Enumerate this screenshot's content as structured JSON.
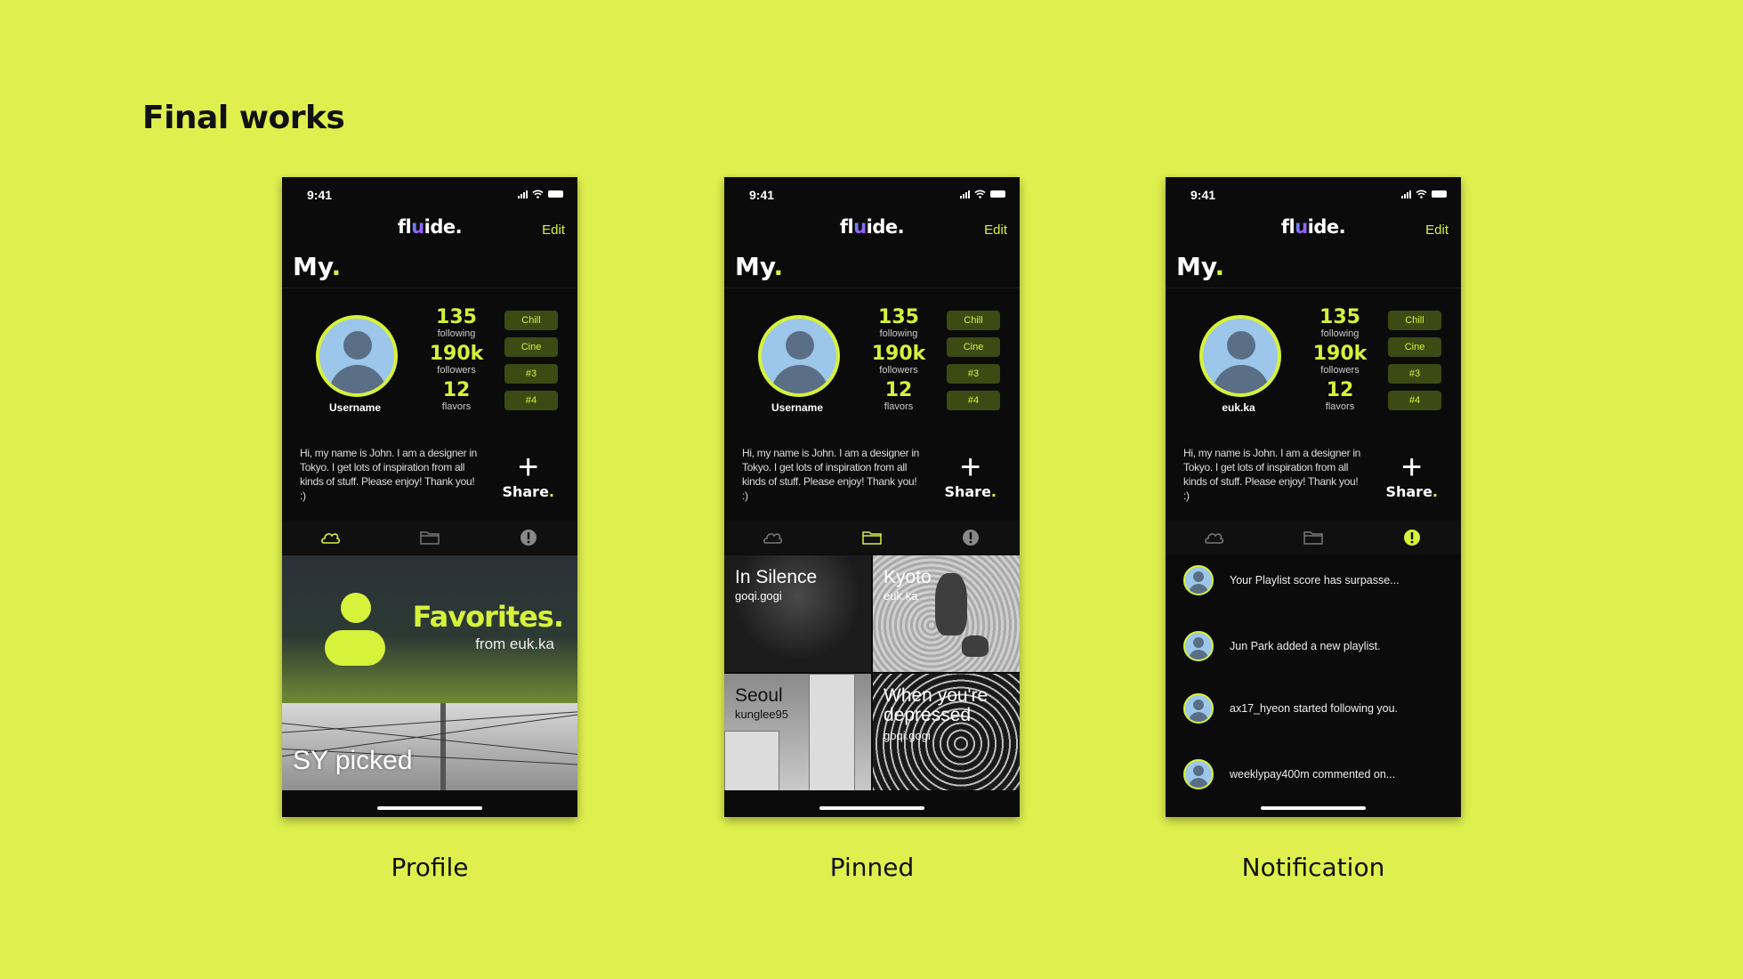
{
  "page_title": "Final works",
  "screens": [
    {
      "caption": "Profile",
      "status_time": "9:41",
      "logo": {
        "pre": "fl",
        "u": "u",
        "post": "ide."
      },
      "edit_label": "Edit",
      "heading": {
        "text": "My",
        "dot": "."
      },
      "username": "Username",
      "stats": [
        {
          "value": "135",
          "label": "following"
        },
        {
          "value": "190k",
          "label": "followers"
        },
        {
          "value": "12",
          "label": "flavors"
        }
      ],
      "tags": [
        "Chill",
        "Cine",
        "#3",
        "#4"
      ],
      "bio": "Hi, my name is John. I am a designer in Tokyo. I get lots of inspiration from all kinds of stuff. Please enjoy! Thank you! :)",
      "share": {
        "plus": "+",
        "label": "Share",
        "dot": "."
      },
      "active_tab": "playlist",
      "favorites": {
        "title": "Favorites.",
        "subtitle": "from euk.ka"
      },
      "picked": "SY picked"
    },
    {
      "caption": "Pinned",
      "status_time": "9:41",
      "logo": {
        "pre": "fl",
        "u": "u",
        "post": "ide."
      },
      "edit_label": "Edit",
      "heading": {
        "text": "My",
        "dot": "."
      },
      "username": "Username",
      "stats": [
        {
          "value": "135",
          "label": "following"
        },
        {
          "value": "190k",
          "label": "followers"
        },
        {
          "value": "12",
          "label": "flavors"
        }
      ],
      "tags": [
        "Chill",
        "Cine",
        "#3",
        "#4"
      ],
      "bio": "Hi, my name is John. I am a designer in Tokyo. I get lots of inspiration from all kinds of stuff. Please enjoy! Thank you! :)",
      "share": {
        "plus": "+",
        "label": "Share",
        "dot": "."
      },
      "active_tab": "folder",
      "pins": [
        {
          "title": "In Silence",
          "user": "goqi.gogi"
        },
        {
          "title": "Kyoto",
          "user": "euk.ka"
        },
        {
          "title": "Seoul",
          "user": "kunglee95"
        },
        {
          "title": "When you're depressed",
          "user": "goqi.gogi"
        }
      ]
    },
    {
      "caption": "Notification",
      "status_time": "9:41",
      "logo": {
        "pre": "fl",
        "u": "u",
        "post": "ide."
      },
      "edit_label": "Edit",
      "heading": {
        "text": "My",
        "dot": "."
      },
      "username": "euk.ka",
      "stats": [
        {
          "value": "135",
          "label": "following"
        },
        {
          "value": "190k",
          "label": "followers"
        },
        {
          "value": "12",
          "label": "flavors"
        }
      ],
      "tags": [
        "Chill",
        "Cine",
        "#3",
        "#4"
      ],
      "bio": "Hi, my name is John. I am a designer in Tokyo. I get lots of inspiration from all kinds of stuff. Please enjoy! Thank you! :)",
      "share": {
        "plus": "+",
        "label": "Share",
        "dot": "."
      },
      "active_tab": "alert",
      "notifications": [
        "Your Playlist score has surpasse...",
        "Jun Park added a new playlist.",
        "ax17_hyeon started following you.",
        "weeklypay400m commented on..."
      ]
    }
  ],
  "colors": {
    "accent": "#d6f23a",
    "background": "#dff04e",
    "phone": "#0b0b0b"
  }
}
